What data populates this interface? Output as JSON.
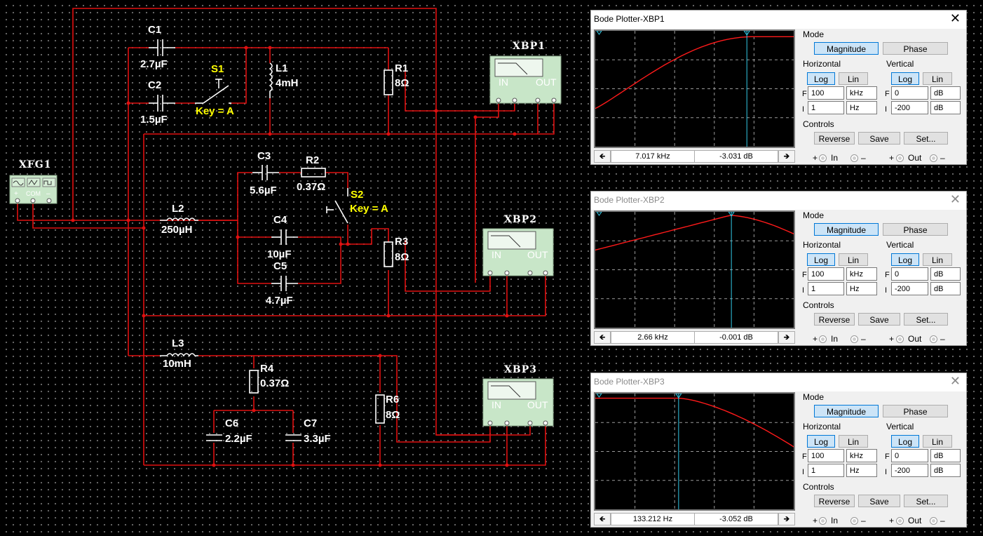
{
  "schematic": {
    "components": {
      "c1": {
        "ref": "C1",
        "value": "2.7µF"
      },
      "c2": {
        "ref": "C2",
        "value": "1.5µF"
      },
      "s1": {
        "ref": "S1",
        "key": "Key = A"
      },
      "l1": {
        "ref": "L1",
        "value": "4mH"
      },
      "r1": {
        "ref": "R1",
        "value": "8Ω"
      },
      "c3": {
        "ref": "C3",
        "value": "5.6µF"
      },
      "r2": {
        "ref": "R2",
        "value": "0.37Ω"
      },
      "s2": {
        "ref": "S2",
        "key": "Key = A"
      },
      "l2": {
        "ref": "L2",
        "value": "250µH"
      },
      "c4": {
        "ref": "C4",
        "value": "10µF"
      },
      "c5": {
        "ref": "C5",
        "value": "4.7µF"
      },
      "r3": {
        "ref": "R3",
        "value": "8Ω"
      },
      "l3": {
        "ref": "L3",
        "value": "10mH"
      },
      "r4": {
        "ref": "R4",
        "value": "0.37Ω"
      },
      "r6": {
        "ref": "R6",
        "value": "8Ω"
      },
      "c6": {
        "ref": "C6",
        "value": "2.2µF"
      },
      "c7": {
        "ref": "C7",
        "value": "3.3µF"
      }
    },
    "instruments": {
      "xfg1": {
        "ref": "XFG1",
        "com": "COM"
      },
      "xbp1": {
        "ref": "XBP1",
        "in": "IN",
        "out": "OUT"
      },
      "xbp2": {
        "ref": "XBP2",
        "in": "IN",
        "out": "OUT"
      },
      "xbp3": {
        "ref": "XBP3",
        "in": "IN",
        "out": "OUT"
      }
    }
  },
  "bode_windows": [
    {
      "title": "Bode Plotter-XBP1",
      "active": true,
      "cursor_fraction": 0.764,
      "curve": "highpass",
      "readout_freq": "7.017 kHz",
      "readout_gain": "-3.031 dB",
      "mode_label": "Mode",
      "magnitude_label": "Magnitude",
      "phase_label": "Phase",
      "horizontal_label": "Horizontal",
      "vertical_label": "Vertical",
      "log_label": "Log",
      "lin_label": "Lin",
      "h_f_value": "100",
      "h_f_unit": "kHz",
      "h_i_value": "1",
      "h_i_unit": "Hz",
      "v_f_value": "0",
      "v_f_unit": "dB",
      "v_i_value": "-200",
      "v_i_unit": "dB",
      "f_label": "F",
      "i_label": "I",
      "controls_label": "Controls",
      "reverse_label": "Reverse",
      "save_label": "Save",
      "set_label": "Set...",
      "in_label": "In",
      "out_label": "Out",
      "plus": "+",
      "minus": "–"
    },
    {
      "title": "Bode Plotter-XBP2",
      "active": false,
      "cursor_fraction": 0.686,
      "curve": "bandpass",
      "readout_freq": "2.66 kHz",
      "readout_gain": "-0.001 dB",
      "mode_label": "Mode",
      "magnitude_label": "Magnitude",
      "phase_label": "Phase",
      "horizontal_label": "Horizontal",
      "vertical_label": "Vertical",
      "log_label": "Log",
      "lin_label": "Lin",
      "h_f_value": "100",
      "h_f_unit": "kHz",
      "h_i_value": "1",
      "h_i_unit": "Hz",
      "v_f_value": "0",
      "v_f_unit": "dB",
      "v_i_value": "-200",
      "v_i_unit": "dB",
      "f_label": "F",
      "i_label": "I",
      "controls_label": "Controls",
      "reverse_label": "Reverse",
      "save_label": "Save",
      "set_label": "Set...",
      "in_label": "In",
      "out_label": "Out",
      "plus": "+",
      "minus": "–"
    },
    {
      "title": "Bode Plotter-XBP3",
      "active": false,
      "cursor_fraction": 0.42,
      "curve": "lowpass",
      "readout_freq": "133.212  Hz",
      "readout_gain": "-3.052 dB",
      "mode_label": "Mode",
      "magnitude_label": "Magnitude",
      "phase_label": "Phase",
      "horizontal_label": "Horizontal",
      "vertical_label": "Vertical",
      "log_label": "Log",
      "lin_label": "Lin",
      "h_f_value": "100",
      "h_f_unit": "kHz",
      "h_i_value": "1",
      "h_i_unit": "Hz",
      "v_f_value": "0",
      "v_f_unit": "dB",
      "v_i_value": "-200",
      "v_i_unit": "dB",
      "f_label": "F",
      "i_label": "I",
      "controls_label": "Controls",
      "reverse_label": "Reverse",
      "save_label": "Save",
      "set_label": "Set...",
      "in_label": "In",
      "out_label": "Out",
      "plus": "+",
      "minus": "–"
    }
  ]
}
